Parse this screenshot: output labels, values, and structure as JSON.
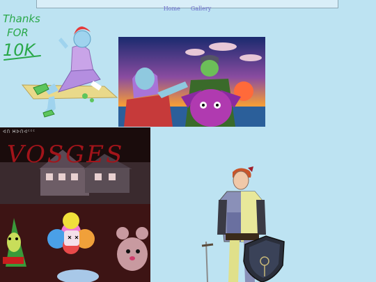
{
  "nav": {
    "items": [
      {
        "label": "Home"
      },
      {
        "label": "Gallery"
      }
    ]
  },
  "artworks": [
    {
      "handwritten_text": [
        "Thanks",
        "FOR",
        "10K"
      ]
    },
    {},
    {
      "painted_title": "VOSGES",
      "signature": "ᐊᑎ ᕼᐅᑎᐊᑦᑦᑦ"
    },
    {}
  ],
  "colors": {
    "background": "#bde3f2",
    "nav_link": "#6a66c8",
    "handwriting": "#2aa84a",
    "title_red": "#a3141a"
  }
}
